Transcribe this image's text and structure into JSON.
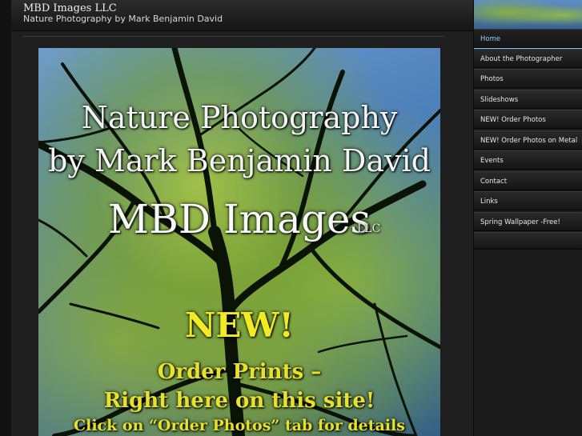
{
  "site": {
    "title": "MBD Images LLC",
    "tagline": "Nature Photography by Mark Benjamin David"
  },
  "hero": {
    "line1": "Nature Photography",
    "line2": "by Mark Benjamin David",
    "brand": "MBD Images",
    "llc": "LLC",
    "new": "NEW!",
    "order": "Order Prints –",
    "right_here": "Right here on this site!",
    "click": "Click on “Order Photos” tab for details"
  },
  "nav": {
    "items": [
      {
        "label": "Home",
        "active": true
      },
      {
        "label": "About the Photographer"
      },
      {
        "label": "Photos"
      },
      {
        "label": "Slideshows"
      },
      {
        "label": "NEW! Order Photos"
      },
      {
        "label": "NEW! Order Photos on Metal"
      },
      {
        "label": "Events"
      },
      {
        "label": "Contact"
      },
      {
        "label": "Links"
      },
      {
        "label": "Spring Wallpaper -Free!"
      }
    ]
  },
  "colors": {
    "accent": "#7ec3f0",
    "promo_text": "#e7e12a"
  }
}
